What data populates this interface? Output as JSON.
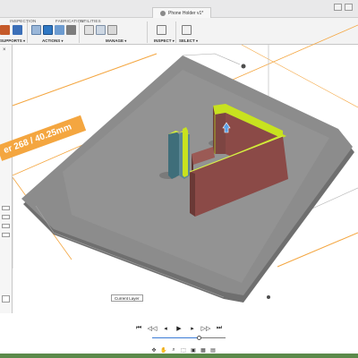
{
  "title_bar": {
    "document_title": "Phone Holder v1*"
  },
  "ribbon": {
    "groups": [
      {
        "label": "INSPECTION",
        "title": "SUPPORTS"
      },
      {
        "label": "FABRICATION",
        "title": "ACTIONS"
      },
      {
        "label": "UTILITIES",
        "title": "MANAGE"
      },
      {
        "label": "",
        "title": "INSPECT"
      },
      {
        "label": "",
        "title": "SELECT"
      }
    ]
  },
  "viewport": {
    "dimension_label": "er 268 / 40.25mm",
    "current_layer_label": "Current Layer"
  },
  "playback": {
    "buttons": [
      "first",
      "step-back",
      "rewind",
      "play",
      "forward",
      "step-forward",
      "last"
    ],
    "progress": 0.64
  },
  "colors": {
    "accent": "#f4a640",
    "plate": "#8c8c8c",
    "part": "#8b4a47",
    "highlight": "#c8e21f"
  }
}
